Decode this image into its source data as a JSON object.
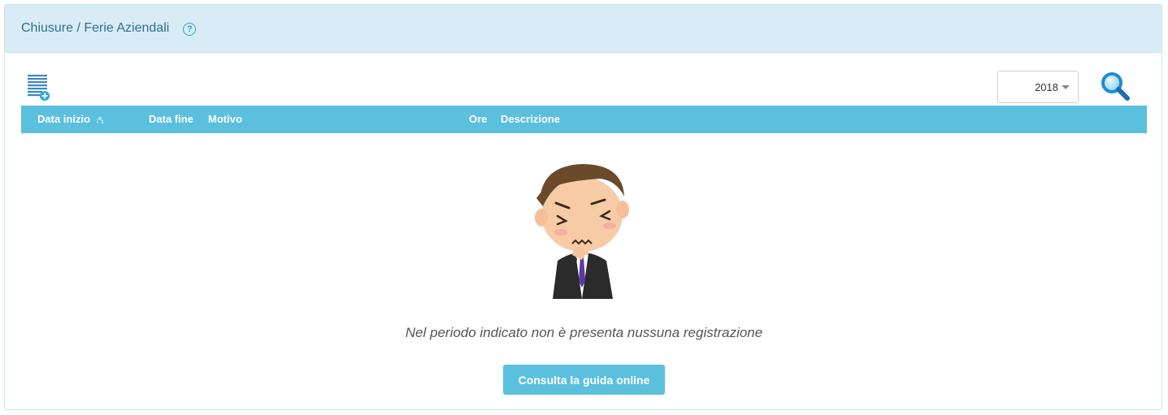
{
  "header": {
    "title": "Chiusure / Ferie Aziendali",
    "help_icon": "question-circle-icon",
    "help_symbol": "?"
  },
  "toolbar": {
    "add_icon": "add-list-icon",
    "year": {
      "selected": "2018"
    },
    "search_icon": "magnifier-icon"
  },
  "table": {
    "columns": [
      {
        "label": "Data inizio",
        "sort_icon": "sort-ascending-icon",
        "sort_symbol": "↓⁰₁"
      },
      {
        "label": "Data fine"
      },
      {
        "label": "Motivo"
      },
      {
        "label": "Ore"
      },
      {
        "label": "Descrizione"
      }
    ]
  },
  "empty_state": {
    "illustration": "confused-businessman-icon",
    "message": "Nel periodo indicato non è presenta nussuna registrazione",
    "button_label": "Consulta la guida online"
  },
  "colors": {
    "accent": "#5bc0de",
    "header_bg": "#d9ecf6",
    "title_text": "#2f6f91"
  }
}
